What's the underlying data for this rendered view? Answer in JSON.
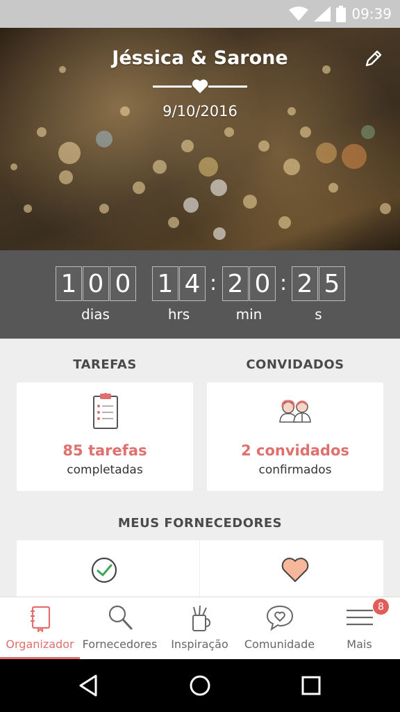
{
  "status_bar": {
    "time": "09:39",
    "icons": [
      "wifi-icon",
      "signal-icon",
      "battery-icon"
    ]
  },
  "hero": {
    "couple_names": "Jéssica & Sarone",
    "wedding_date": "9/10/2016"
  },
  "countdown": {
    "days_digits": [
      "1",
      "0",
      "0"
    ],
    "hours_digits": [
      "1",
      "4"
    ],
    "minutes_digits": [
      "2",
      "0"
    ],
    "seconds_digits": [
      "2",
      "5"
    ],
    "days_label": "dias",
    "hours_label": "hrs",
    "minutes_label": "min",
    "seconds_label": "s"
  },
  "summary": {
    "tasks_title": "TAREFAS",
    "tasks_count": "85 tarefas",
    "tasks_sub": "completadas",
    "guests_title": "CONVIDADOS",
    "guests_count": "2 convidados",
    "guests_sub": "confirmados"
  },
  "vendors": {
    "title": "MEUS FORNECEDORES"
  },
  "bottom_nav": {
    "items": [
      {
        "label": "Organizador",
        "icon": "notebook-icon",
        "active": true
      },
      {
        "label": "Fornecedores",
        "icon": "search-icon",
        "active": false
      },
      {
        "label": "Inspiração",
        "icon": "pencil-cup-icon",
        "active": false
      },
      {
        "label": "Comunidade",
        "icon": "chat-heart-icon",
        "active": false
      },
      {
        "label": "Mais",
        "icon": "menu-icon",
        "active": false
      }
    ],
    "more_badge": "8"
  },
  "colors": {
    "accent": "#e0706e",
    "countdown_bg": "#575757",
    "page_bg": "#eeeeee"
  }
}
